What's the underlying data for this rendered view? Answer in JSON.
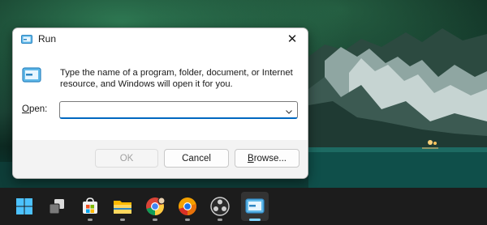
{
  "dialog": {
    "title": "Run",
    "description": "Type the name of a program, folder, document, or Internet resource, and Windows will open it for you.",
    "open_label_accel": "O",
    "open_label_rest": "pen:",
    "open_value": "",
    "buttons": {
      "ok": "OK",
      "cancel": "Cancel",
      "browse_accel": "B",
      "browse_rest": "rowse..."
    },
    "close_glyph": "✕"
  },
  "taskbar": {
    "icons": [
      "start-icon",
      "task-view-icon",
      "microsoft-store-icon",
      "file-explorer-icon",
      "chrome-icon",
      "chrome-canary-icon",
      "obs-icon",
      "run-icon"
    ]
  },
  "colors": {
    "accent": "#0067c0",
    "taskbar": "#1c1c1c",
    "dialog_footer": "#f3f3f3"
  }
}
